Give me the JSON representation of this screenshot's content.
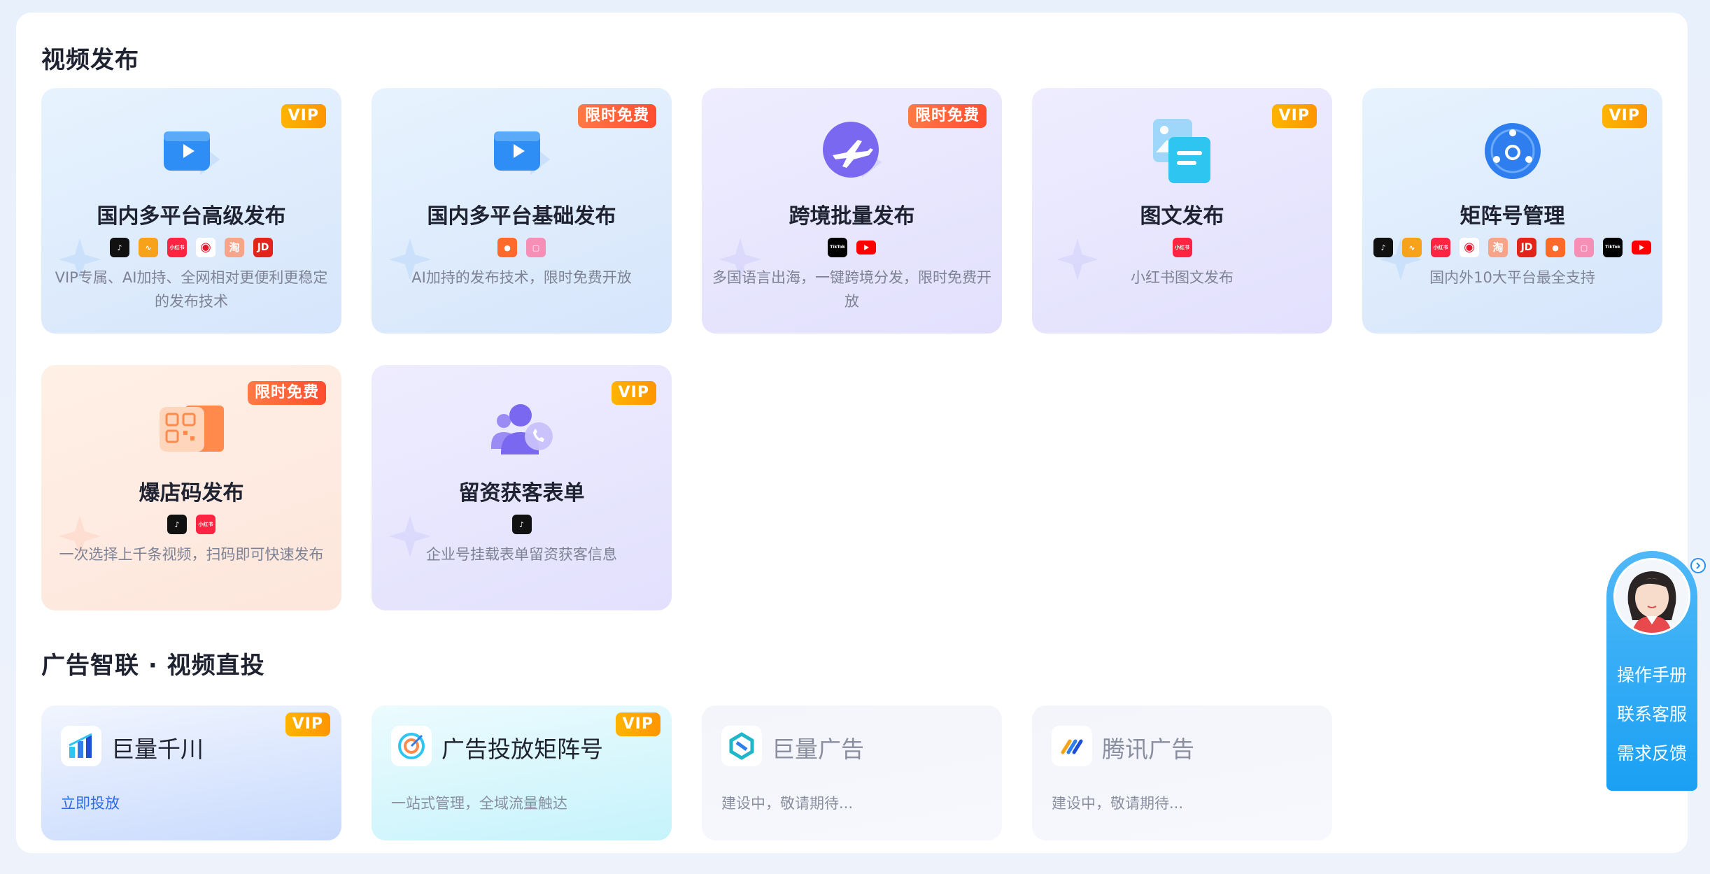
{
  "sections": {
    "video_publish": "视频发布",
    "ads": "广告智联 · 视频直投"
  },
  "cards": [
    {
      "title": "国内多平台高级发布",
      "badge": "VIP",
      "desc": "VIP专属、AI加持、全网相对更便利更稳定的发布技术",
      "platforms": [
        "douyin-icon",
        "wechat-channels-icon",
        "xiaohongshu-icon",
        "weibo-icon",
        "taobao-icon",
        "jd-icon"
      ]
    },
    {
      "title": "国内多平台基础发布",
      "badge": "限时免费",
      "desc": "AI加持的发布技术，限时免费开放",
      "platforms": [
        "kuaishou-icon",
        "bilibili-icon"
      ]
    },
    {
      "title": "跨境批量发布",
      "badge": "限时免费",
      "desc": "多国语言出海，一键跨境分发，限时免费开放",
      "platforms": [
        "tiktok-icon",
        "youtube-icon"
      ]
    },
    {
      "title": "图文发布",
      "badge": "VIP",
      "desc": "小红书图文发布",
      "platforms": [
        "xiaohongshu-icon"
      ]
    },
    {
      "title": "矩阵号管理",
      "badge": "VIP",
      "desc": "国内外10大平台最全支持",
      "platforms": [
        "douyin-icon",
        "wechat-channels-icon",
        "xiaohongshu-icon",
        "weibo-icon",
        "taobao-icon",
        "jd-icon",
        "kuaishou-icon",
        "bilibili-icon",
        "tiktok-icon",
        "youtube-icon"
      ]
    },
    {
      "title": "爆店码发布",
      "badge": "限时免费",
      "desc": "一次选择上千条视频，扫码即可快速发布",
      "platforms": [
        "douyin-icon",
        "xiaohongshu-icon"
      ]
    },
    {
      "title": "留资获客表单",
      "badge": "VIP",
      "desc": "企业号挂载表单留资获客信息",
      "platforms": [
        "douyin-icon"
      ]
    }
  ],
  "ad_cards": [
    {
      "title": "巨量千川",
      "badge": "VIP",
      "link": "立即投放"
    },
    {
      "title": "广告投放矩阵号",
      "badge": "VIP",
      "desc": "一站式管理，全域流量触达"
    },
    {
      "title": "巨量广告",
      "desc": "建设中，敬请期待..."
    },
    {
      "title": "腾讯广告",
      "desc": "建设中，敬请期待..."
    }
  ],
  "platform_text": {
    "xiaohongshu": "小红书",
    "taobao": "淘",
    "jd": "JD",
    "tiktok": "TikTok"
  },
  "sidebar": {
    "manual": "操作手册",
    "support": "联系客服",
    "feedback": "需求反馈"
  },
  "colors": {
    "vip_badge": "#ff9f00",
    "free_badge": "#ff5a33",
    "link": "#2e6be6",
    "sidebar": "#29a8f5"
  }
}
